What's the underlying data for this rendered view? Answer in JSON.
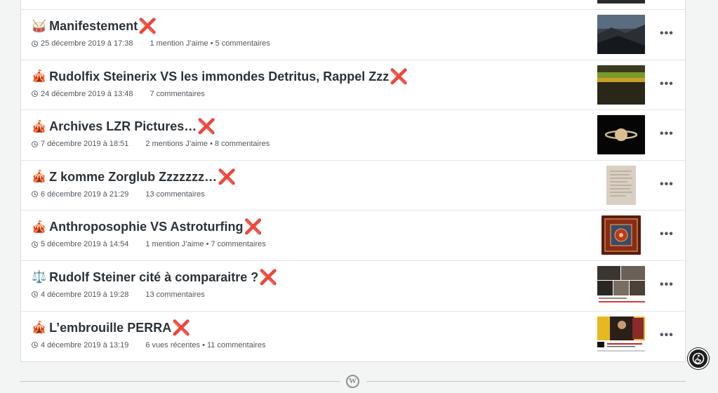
{
  "posts": [
    {
      "emoji": "🥁",
      "title": "Manifestement",
      "date": "25 décembre 2019 à 17:38",
      "stats": "1 mention J’aime • 5 commentaires"
    },
    {
      "emoji": "🎪",
      "title": "Rudolfix Steinerix VS les immondes Detritus, Rappel Zzz",
      "date": "24 décembre 2019 à 13:48",
      "stats": "7 commentaires"
    },
    {
      "emoji": "🎪",
      "title": "Archives LZR Pictures…",
      "date": "7 décembre 2019 à 18:51",
      "stats": "2 mentions J’aime • 8 commentaires"
    },
    {
      "emoji": "🎪",
      "title": "Z komme Zorglub Zzzzzzz…",
      "date": "6 décembre 2019 à 21:29",
      "stats": "13 commentaires"
    },
    {
      "emoji": "🎪",
      "title": "Anthroposophie VS Astroturfing",
      "date": "5 décembre 2019 à 14:54",
      "stats": "1 mention J’aime • 7 commentaires"
    },
    {
      "emoji": "⚖️",
      "title": "Rudolf Steiner cité à comparaitre ?",
      "date": "4 décembre 2019 à 19:28",
      "stats": "13 commentaires"
    },
    {
      "emoji": "🎪",
      "title": "L’embrouille PERRA",
      "date": "4 décembre 2019 à 13:19",
      "stats": "6 vues récentes • 11 commentaires"
    }
  ],
  "x_mark": "❌",
  "more_label": "•••",
  "colors": {
    "accent_red": "#e0201b",
    "text": "#2c3338",
    "meta": "#50575e"
  }
}
